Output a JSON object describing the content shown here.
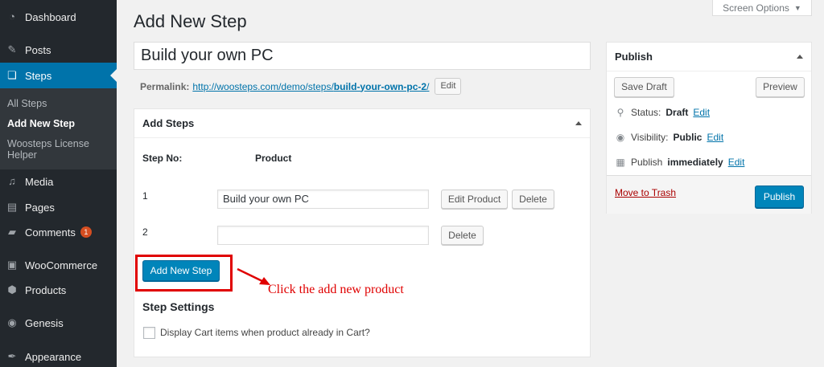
{
  "sidebar": {
    "items": [
      {
        "label": "Dashboard",
        "icon": "dashboard-icon"
      },
      {
        "label": "Posts",
        "icon": "pin-icon"
      },
      {
        "label": "Steps",
        "icon": "steps-icon"
      },
      {
        "label": "Media",
        "icon": "media-icon"
      },
      {
        "label": "Pages",
        "icon": "pages-icon"
      },
      {
        "label": "Comments",
        "icon": "comments-icon",
        "badge": "1"
      },
      {
        "label": "WooCommerce",
        "icon": "woocommerce-icon"
      },
      {
        "label": "Products",
        "icon": "products-icon"
      },
      {
        "label": "Genesis",
        "icon": "genesis-icon"
      },
      {
        "label": "Appearance",
        "icon": "appearance-icon"
      }
    ],
    "submenu": [
      "All Steps",
      "Add New Step",
      "Woosteps License",
      "Helper"
    ]
  },
  "header": {
    "title": "Add New Step",
    "screen_options": "Screen Options"
  },
  "editor": {
    "title_value": "Build your own PC",
    "permalink_label": "Permalink:",
    "permalink_base": "http://woosteps.com/demo/steps/",
    "permalink_slug": "build-your-own-pc-2",
    "permalink_trail": "/",
    "edit_label": "Edit"
  },
  "add_steps": {
    "heading": "Add Steps",
    "col_step": "Step No:",
    "col_product": "Product",
    "rows": [
      {
        "num": "1",
        "value": "Build your own PC",
        "edit": "Edit Product",
        "delete": "Delete"
      },
      {
        "num": "2",
        "value": "",
        "delete": "Delete"
      }
    ],
    "add_button": "Add New Step",
    "settings_heading": "Step Settings",
    "checkbox_label": "Display Cart items when product already in Cart?"
  },
  "annotation": {
    "text": "Click the add new product",
    "color": "#e00000"
  },
  "publish": {
    "heading": "Publish",
    "save_draft": "Save Draft",
    "preview": "Preview",
    "status_label": "Status:",
    "status_value": "Draft",
    "visibility_label": "Visibility:",
    "visibility_value": "Public",
    "publish_label": "Publish",
    "publish_value": "immediately",
    "edit": "Edit",
    "trash": "Move to Trash",
    "publish_button": "Publish"
  },
  "colors": {
    "sidebar_bg": "#23282d",
    "active": "#0073aa",
    "primary_button": "#0085ba",
    "trash": "#a00"
  }
}
